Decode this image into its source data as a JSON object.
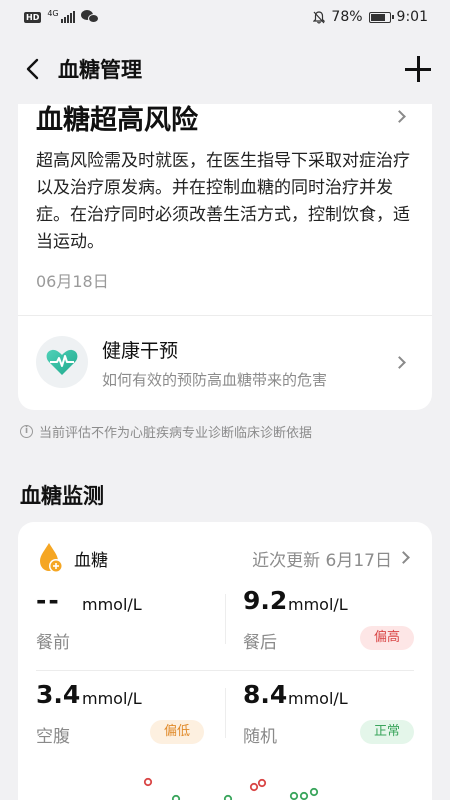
{
  "status_bar": {
    "left_badge": "HD",
    "network": "4G",
    "battery": "78%",
    "time": "9:01",
    "battery_level": 0.78
  },
  "appbar": {
    "title": "血糖管理"
  },
  "risk_card": {
    "title": "血糖超高风险",
    "description": "超高风险需及时就医，在医生指导下采取对症治疗以及治疗原发病。并在控制血糖的同时治疗并发症。在治疗同时必须改善生活方式，控制饮食，适当运动。",
    "date": "06月18日",
    "health": {
      "title": "健康干预",
      "subtitle": "如何有效的预防高血糖带来的危害"
    }
  },
  "disclaimer": "当前评估不作为心脏疾病专业诊断临床诊断依据",
  "section_title": "血糖监测",
  "monitor": {
    "label": "血糖",
    "update": "近次更新 6月17日",
    "metrics": [
      {
        "value": "--",
        "unit": "mmol/L",
        "name": "餐前",
        "badge": ""
      },
      {
        "value": "9.2",
        "unit": "mmol/L",
        "name": "餐后",
        "badge": "偏高"
      },
      {
        "value": "3.4",
        "unit": "mmol/L",
        "name": "空腹",
        "badge": "偏低"
      },
      {
        "value": "8.4",
        "unit": "mmol/L",
        "name": "随机",
        "badge": "正常"
      }
    ]
  },
  "colors": {
    "high": "#d94646",
    "low": "#e08a2a",
    "normal": "#3aa55c",
    "accent_orange": "#f5a623"
  },
  "chart_data": {
    "type": "scatter",
    "points": [
      {
        "status": "high"
      },
      {
        "status": "normal"
      },
      {
        "status": "normal"
      },
      {
        "status": "high"
      },
      {
        "status": "high"
      },
      {
        "status": "normal"
      },
      {
        "status": "normal"
      },
      {
        "status": "normal"
      }
    ]
  }
}
